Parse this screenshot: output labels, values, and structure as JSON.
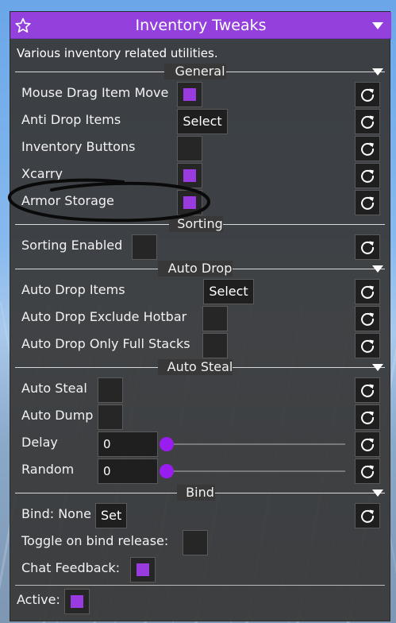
{
  "window": {
    "title": "Inventory Tweaks",
    "description": "Various inventory related utilities."
  },
  "colors": {
    "accent": "#9340dc",
    "check": "#9a3be0",
    "panel": "#383838"
  },
  "sections": {
    "general": "General",
    "sorting": "Sorting",
    "auto_drop": "Auto Drop",
    "auto_steal": "Auto Steal",
    "bind": "Bind"
  },
  "rows": {
    "mouse_drag": {
      "label": "Mouse Drag Item Move",
      "checked": true
    },
    "anti_drop": {
      "label": "Anti Drop Items",
      "button": "Select"
    },
    "inv_buttons": {
      "label": "Inventory Buttons",
      "checked": false
    },
    "xcarry": {
      "label": "Xcarry",
      "checked": true
    },
    "armor_storage": {
      "label": "Armor Storage",
      "checked": true
    },
    "sorting_enabled": {
      "label": "Sorting Enabled",
      "checked": false
    },
    "auto_drop_items": {
      "label": "Auto Drop Items",
      "button": "Select"
    },
    "auto_drop_exclude": {
      "label": "Auto Drop Exclude Hotbar",
      "checked": false
    },
    "auto_drop_full": {
      "label": "Auto Drop Only Full Stacks",
      "checked": false
    },
    "auto_steal": {
      "label": "Auto Steal",
      "checked": false
    },
    "auto_dump": {
      "label": "Auto Dump",
      "checked": false
    },
    "delay": {
      "label": "Delay",
      "value": "0",
      "slider": 0
    },
    "random": {
      "label": "Random",
      "value": "0",
      "slider": 0
    },
    "bind": {
      "label": "Bind: None",
      "button": "Set"
    },
    "toggle_release": {
      "label": "Toggle on bind release:",
      "checked": false
    },
    "chat_feedback": {
      "label": "Chat Feedback:",
      "checked": true
    },
    "active": {
      "label": "Active:",
      "checked": true
    }
  },
  "icons": {
    "favorite": "star-icon",
    "collapse": "triangle-down-icon",
    "reset": "refresh-icon"
  }
}
